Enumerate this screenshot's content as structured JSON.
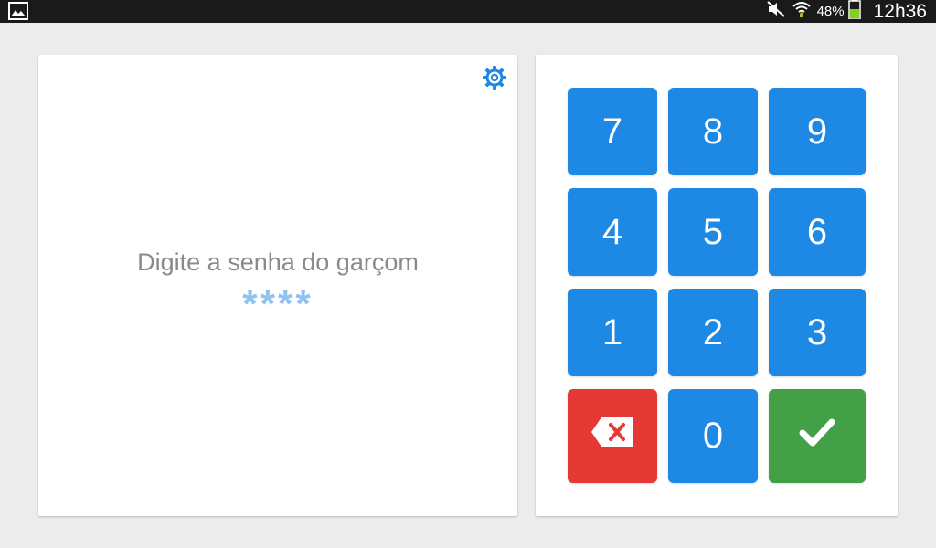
{
  "status_bar": {
    "battery_percent": "48%",
    "time": "12h36",
    "icons": [
      "gallery-icon",
      "mute-icon",
      "wifi-icon",
      "battery-icon"
    ]
  },
  "login": {
    "prompt": "Digite a senha do garçom",
    "password_mask": "****",
    "settings_icon": "gear-icon"
  },
  "keypad": {
    "keys": [
      "7",
      "8",
      "9",
      "4",
      "5",
      "6",
      "1",
      "2",
      "3"
    ],
    "zero": "0",
    "delete_icon": "backspace-icon",
    "confirm_icon": "check-icon"
  },
  "colors": {
    "key_blue": "#1e88e5",
    "delete_red": "#e53935",
    "confirm_green": "#43a047",
    "mask_blue": "#8ec2f1",
    "prompt_gray": "#8a8a8a"
  }
}
